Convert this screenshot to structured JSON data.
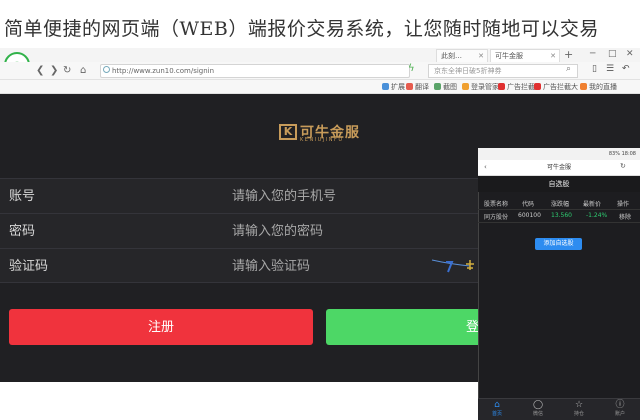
{
  "banner": {
    "text": "简单便捷的网页端（WEB）端报价交易系统，让您随时随地可以交易"
  },
  "browser": {
    "logo": "e",
    "tabs": [
      {
        "label": "此刻…"
      },
      {
        "label": "可牛金服"
      }
    ],
    "window_controls": [
      "─",
      "□",
      "✕"
    ],
    "url": "http://www.zun10.com/signin",
    "search_placeholder": "京东全神日破5折神券",
    "bookmarks": [
      {
        "label": "扩展",
        "color": "#4a90d9"
      },
      {
        "label": "翻译",
        "color": "#e65c4f"
      },
      {
        "label": "截图",
        "color": "#5aa469"
      },
      {
        "label": "登录管家",
        "color": "#f0a030"
      },
      {
        "label": "广告拦截",
        "color": "#e03030"
      },
      {
        "label": "广告拦截大",
        "color": "#e03030"
      },
      {
        "label": "我的直播",
        "color": "#f08030"
      }
    ]
  },
  "site": {
    "logo_mark": "K",
    "logo_text": "可牛金服",
    "logo_sub": "KENIUJINFU",
    "form": {
      "account_label": "账号",
      "account_placeholder": "请输入您的手机号",
      "password_label": "密码",
      "password_placeholder": "请输入您的密码",
      "captcha_label": "验证码",
      "captcha_placeholder": "请输入验证码"
    },
    "register_button": "注册",
    "login_button": "登"
  },
  "phone": {
    "status_right": "83% 18:08",
    "title": "可牛金服",
    "page_title": "自选股",
    "table": {
      "columns": [
        "股票名称",
        "代码",
        "涨跌幅",
        "最新价",
        "操作"
      ],
      "rows": [
        {
          "name": "同方股份",
          "code": "600100",
          "change": "13.560",
          "price": "-1.24%",
          "action": "移除"
        }
      ]
    },
    "add_button": "添加自选股",
    "tabs": [
      {
        "label": "首页",
        "icon": "⌂",
        "active": true
      },
      {
        "label": "微信",
        "icon": "◯",
        "active": false
      },
      {
        "label": "持仓",
        "icon": "☆",
        "active": false
      },
      {
        "label": "账户",
        "icon": "ⓘ",
        "active": false
      }
    ],
    "colors": {
      "up": "#2ecc71",
      "down": "#e74c3c",
      "accent": "#2d8cf0"
    }
  }
}
